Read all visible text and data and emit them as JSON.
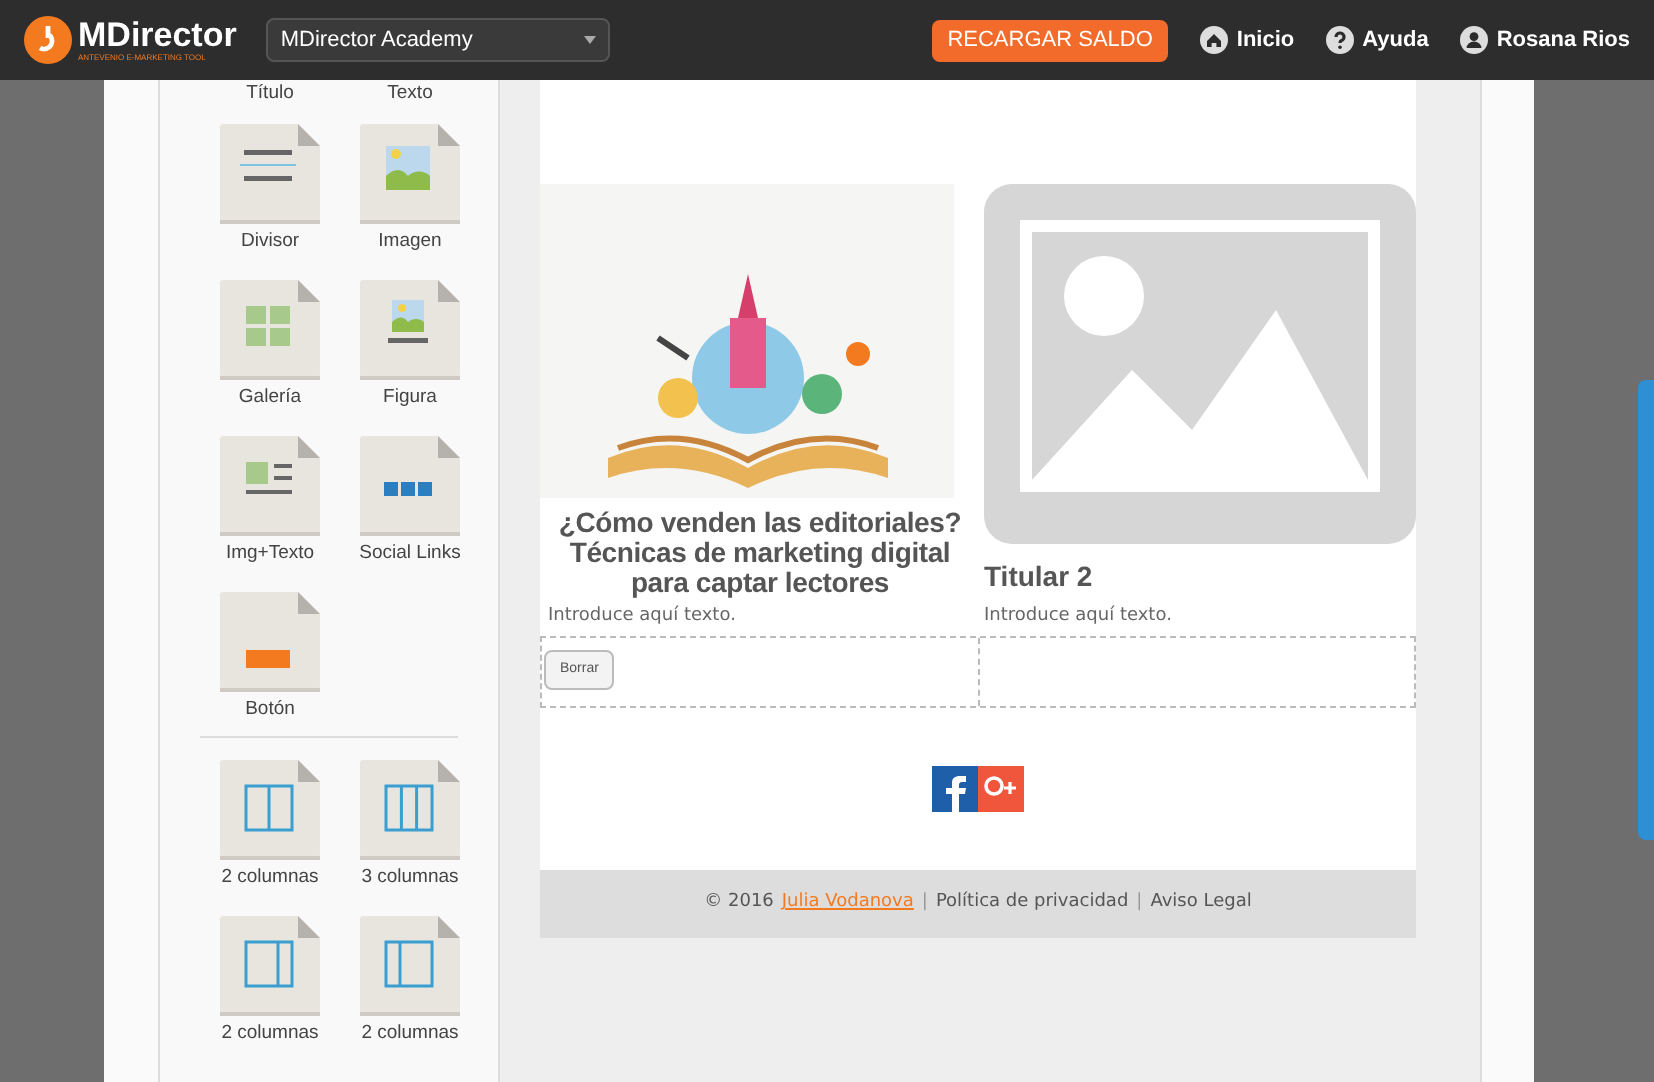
{
  "topbar": {
    "logo": "MDirector",
    "logo_tagline": "ANTEVENIO E-MARKETING TOOL",
    "account": "MDirector Academy",
    "recharge": "RECARGAR SALDO",
    "links": [
      {
        "kind": "home",
        "label": "Inicio"
      },
      {
        "kind": "help",
        "label": "Ayuda"
      },
      {
        "kind": "user",
        "label": "Rosana Rios"
      }
    ]
  },
  "sidebar": {
    "top_labels": [
      "Título",
      "Texto"
    ],
    "blocks": [
      {
        "kind": "divider",
        "label": "Divisor"
      },
      {
        "kind": "image",
        "label": "Imagen"
      },
      {
        "kind": "gallery",
        "label": "Galería"
      },
      {
        "kind": "figure",
        "label": "Figura"
      },
      {
        "kind": "imgtext",
        "label": "Img+Texto"
      },
      {
        "kind": "social",
        "label": "Social Links"
      },
      {
        "kind": "button",
        "label": "Botón"
      }
    ],
    "layouts": [
      {
        "kind": "cols2",
        "label": "2 columnas"
      },
      {
        "kind": "cols3",
        "label": "3 columnas"
      },
      {
        "kind": "cols2left",
        "label": "2 columnas"
      },
      {
        "kind": "cols2right",
        "label": "2 columnas"
      }
    ]
  },
  "email": {
    "columns": [
      {
        "kind": "photo",
        "title": "¿Cómo venden las editoriales? Técnicas de marketing digital para captar lectores",
        "text": "Introduce aquí texto."
      },
      {
        "kind": "placeholder",
        "title": "Titular 2",
        "text": "Introduce aquí texto."
      }
    ],
    "delete_button": "Borrar",
    "footer": {
      "year": "© 2016",
      "author": "Julia Vodanova",
      "separator_1": "|",
      "privacy": "Política de privacidad",
      "separator_2": "|",
      "legal": "Aviso Legal"
    }
  }
}
